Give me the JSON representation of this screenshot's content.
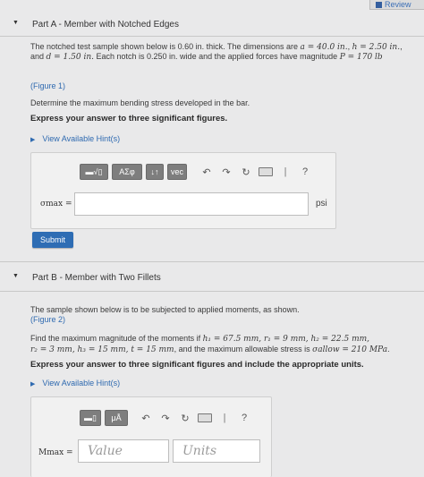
{
  "review": {
    "label": "Review"
  },
  "partA": {
    "title": "Part A - Member with Notched Edges",
    "line1_pre": "The notched test sample shown below is 0.60 in. thick. The dimensions are ",
    "line1_a": "a = 40.0 in.",
    "line1_mid": ", ",
    "line1_h": "h = 2.50 in.",
    "line1_post": ",",
    "line2_pre": "and ",
    "line2_d": "d = 1.50 in.",
    "line2_mid": " Each notch is 0.250 in. wide and the applied forces have magnitude ",
    "line2_P": "P = 170 lb",
    "figure_link": "(Figure 1)",
    "task": "Determine the maximum bending stress developed in the bar.",
    "instruction": "Express your answer to three significant figures.",
    "hints": "View Available Hint(s)",
    "toolbar": {
      "b1": "▬√▯",
      "b2": "ΑΣφ",
      "b3": "↓↑",
      "b4": "vec",
      "help": "?"
    },
    "var_label": "σmax =",
    "input_value": "",
    "unit": "psi",
    "submit": "Submit"
  },
  "partB": {
    "title": "Part B - Member with Two Fillets",
    "line1": "The sample shown below is to be subjected to applied moments, as shown.",
    "figure_link": "(Figure 2)",
    "line3_pre": "Find the maximum magnitude of the moments if ",
    "line3_math": "h₁ = 67.5 mm, r₁ = 9 mm, h₂ = 22.5 mm,",
    "line4_math": "r₂ = 3 mm, h₃ = 15 mm, t = 15 mm",
    "line4_mid": ", and the maximum allowable stress is ",
    "line4_sigma": "σallow = 210 MPa",
    "line4_post": ".",
    "instruction": "Express your answer to three significant figures and include the appropriate units.",
    "hints": "View Available Hint(s)",
    "toolbar": {
      "b1": "▬▯",
      "b2": "μÅ",
      "help": "?"
    },
    "var_label": "Mmax =",
    "value_placeholder": "Value",
    "units_placeholder": "Units"
  }
}
